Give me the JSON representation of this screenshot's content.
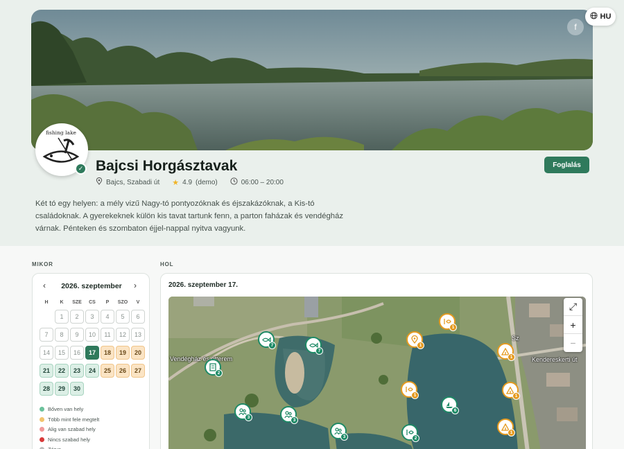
{
  "lang": {
    "code": "HU"
  },
  "venue": {
    "name": "Bajcsi Horgásztavak",
    "logo_text": "fishing lake",
    "location": "Bajcs, Szabadi út",
    "rating": "4.9",
    "rating_note": "(demo)",
    "hours": "06:00 – 20:00",
    "book_label": "Foglalás",
    "description": "Két tó egy helyen: a mély vizű Nagy-tó pontyozóknak és éjszakázóknak, a Kis-tó családoknak. A gyerekeknek külön kis tavat tartunk fenn, a parton faházak és vendégház várnak. Pénteken és szombaton éjjel-nappal nyitva vagyunk."
  },
  "sections": {
    "when": "MIKOR",
    "where": "HOL"
  },
  "calendar": {
    "month": "2026. szeptember",
    "dows": [
      "H",
      "K",
      "SZE",
      "CS",
      "P",
      "SZO",
      "V"
    ],
    "days": [
      {
        "n": "1",
        "s": "past"
      },
      {
        "n": "2",
        "s": "past"
      },
      {
        "n": "3",
        "s": "past"
      },
      {
        "n": "4",
        "s": "past"
      },
      {
        "n": "5",
        "s": "past"
      },
      {
        "n": "6",
        "s": "past"
      },
      {
        "n": "7",
        "s": "past"
      },
      {
        "n": "8",
        "s": "past"
      },
      {
        "n": "9",
        "s": "past"
      },
      {
        "n": "10",
        "s": "past"
      },
      {
        "n": "11",
        "s": "past"
      },
      {
        "n": "12",
        "s": "past"
      },
      {
        "n": "13",
        "s": "past"
      },
      {
        "n": "14",
        "s": "past"
      },
      {
        "n": "15",
        "s": "past"
      },
      {
        "n": "16",
        "s": "past"
      },
      {
        "n": "17",
        "s": "selected"
      },
      {
        "n": "18",
        "s": "half"
      },
      {
        "n": "19",
        "s": "half"
      },
      {
        "n": "20",
        "s": "half"
      },
      {
        "n": "21",
        "s": "plenty"
      },
      {
        "n": "22",
        "s": "plenty"
      },
      {
        "n": "23",
        "s": "plenty"
      },
      {
        "n": "24",
        "s": "plenty"
      },
      {
        "n": "25",
        "s": "half"
      },
      {
        "n": "26",
        "s": "half"
      },
      {
        "n": "27",
        "s": "half"
      },
      {
        "n": "28",
        "s": "plenty"
      },
      {
        "n": "29",
        "s": "plenty"
      },
      {
        "n": "30",
        "s": "plenty"
      }
    ],
    "legend": [
      {
        "label": "Bőven van hely",
        "color": "#6cc29c"
      },
      {
        "label": "Több mint fele megtelt",
        "color": "#f2c46d"
      },
      {
        "label": "Alig van szabad hely",
        "color": "#f09a9a"
      },
      {
        "label": "Nincs szabad hely",
        "color": "#d83a3a"
      },
      {
        "label": "Zárva",
        "color": "#bdbdbd"
      }
    ]
  },
  "map": {
    "date": "2026. szeptember 17.",
    "street_label": "Kendereskerti út",
    "road_label": "Sz",
    "building_label": "Vendégház és étterem",
    "pins": [
      {
        "icon": "fish-icon",
        "count": "7",
        "kind": "plenty"
      },
      {
        "icon": "fish-icon",
        "count": "7",
        "kind": "plenty"
      },
      {
        "icon": "building-icon",
        "count": "2",
        "kind": "plenty"
      },
      {
        "icon": "fish-swim-icon",
        "count": "1",
        "kind": "half"
      },
      {
        "icon": "location-icon",
        "count": "1",
        "kind": "half"
      },
      {
        "icon": "tent-icon",
        "count": "1",
        "kind": "half"
      },
      {
        "icon": "fish-swim-icon",
        "count": "1",
        "kind": "half"
      },
      {
        "icon": "tent-icon",
        "count": "1",
        "kind": "half"
      },
      {
        "icon": "boat-icon",
        "count": "6",
        "kind": "plenty"
      },
      {
        "icon": "people-icon",
        "count": "3",
        "kind": "plenty"
      },
      {
        "icon": "people-icon",
        "count": "3",
        "kind": "plenty"
      },
      {
        "icon": "people-icon",
        "count": "3",
        "kind": "plenty"
      },
      {
        "icon": "fish-swim-icon",
        "count": "2",
        "kind": "plenty"
      },
      {
        "icon": "tent-icon",
        "count": "1",
        "kind": "half"
      }
    ]
  }
}
